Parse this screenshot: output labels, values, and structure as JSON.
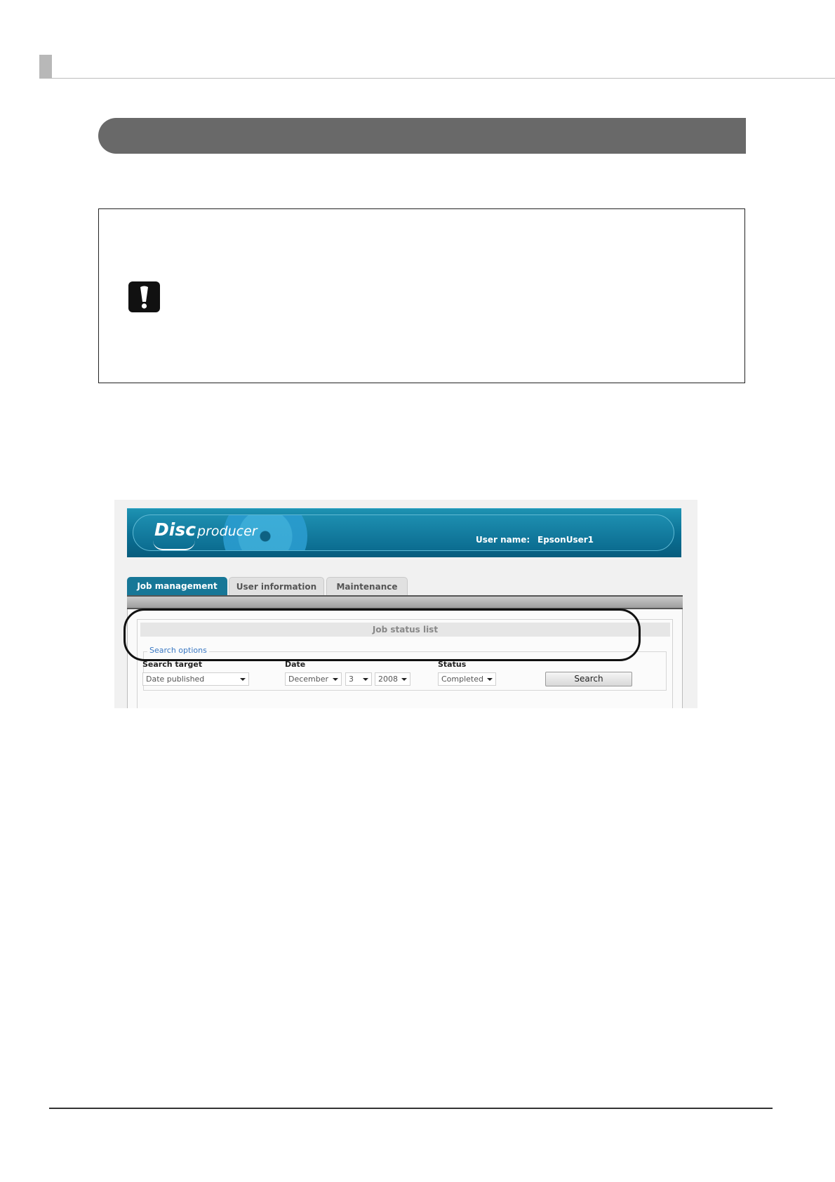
{
  "important_icon": "exclamation-icon",
  "app": {
    "logo_word1": "Disc",
    "logo_word2": "producer",
    "user_label": "User name:",
    "user_value": "EpsonUser1"
  },
  "tabs": [
    {
      "label": "Job management",
      "active": true
    },
    {
      "label": "User information",
      "active": false
    },
    {
      "label": "Maintenance",
      "active": false
    }
  ],
  "job_status": {
    "title": "Job status list",
    "search_options_legend": "Search options",
    "fields": {
      "search_target_label": "Search target",
      "date_label": "Date",
      "status_label": "Status"
    },
    "values": {
      "search_target": "Date published",
      "month": "December",
      "day": "3",
      "year": "2008",
      "status": "Completed"
    },
    "search_button": "Search"
  },
  "colors": {
    "section_bar": "#696969",
    "banner": "#0a6f93",
    "active_tab": "#177797",
    "legend": "#3a78c3"
  }
}
